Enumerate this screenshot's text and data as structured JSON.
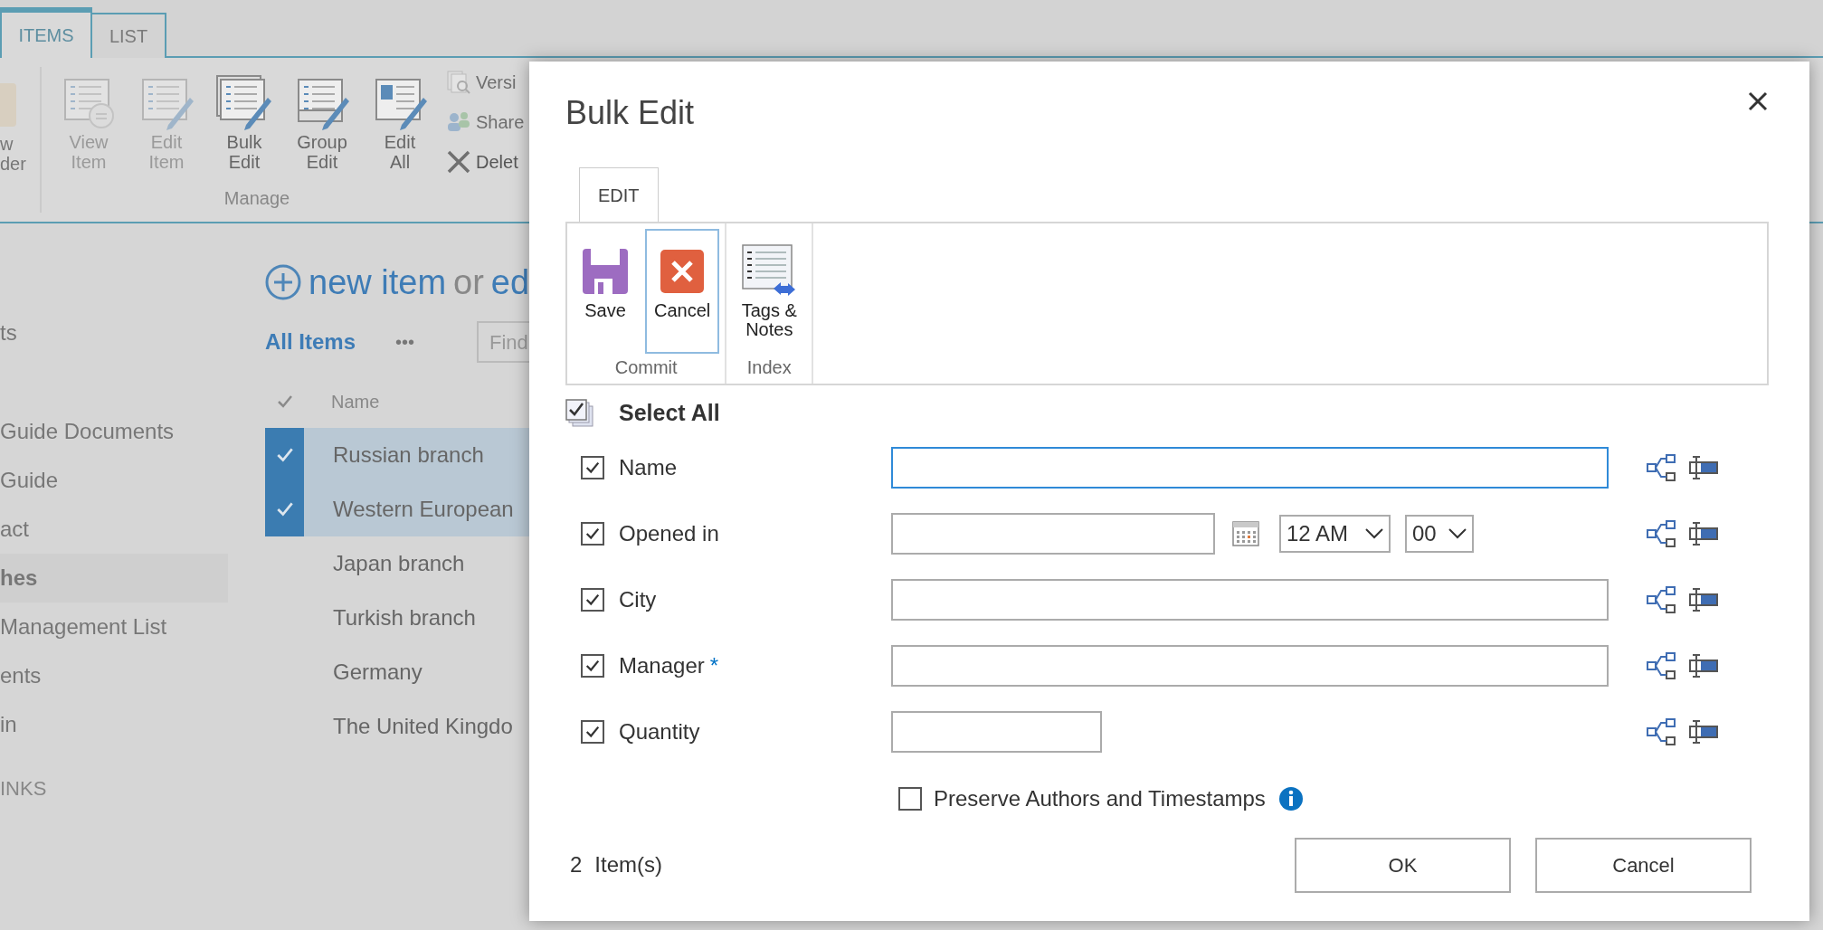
{
  "ribbon_tabs": [
    {
      "label": "ITEMS",
      "selected": true
    },
    {
      "label": "LIST",
      "selected": false
    }
  ],
  "ribbon": {
    "cut_button": {
      "lines": [
        "w",
        "der"
      ]
    },
    "large_buttons": [
      {
        "kind": "view",
        "lines": [
          "View",
          "Item"
        ],
        "disabled": true
      },
      {
        "kind": "edit",
        "lines": [
          "Edit",
          "Item"
        ],
        "disabled": true
      },
      {
        "kind": "bulk",
        "lines": [
          "Bulk",
          "Edit"
        ],
        "disabled": false
      },
      {
        "kind": "group",
        "lines": [
          "Group",
          "Edit"
        ],
        "disabled": false
      },
      {
        "kind": "editall",
        "lines": [
          "Edit",
          "All"
        ],
        "disabled": false
      }
    ],
    "group_label": "Manage",
    "small_buttons": [
      {
        "kind": "versions",
        "label": "Versi",
        "disabled": true
      },
      {
        "kind": "share",
        "label": "Share",
        "disabled": true
      },
      {
        "kind": "delete",
        "label": "Delet",
        "disabled": false
      }
    ]
  },
  "left_nav": {
    "items": [
      {
        "label": "ts",
        "selected": false
      },
      {
        "label": "Guide Documents",
        "selected": false
      },
      {
        "label": "Guide",
        "selected": false
      },
      {
        "label": "act",
        "selected": false
      },
      {
        "label": "hes",
        "selected": true
      },
      {
        "label": "Management List",
        "selected": false
      },
      {
        "label": "ents",
        "selected": false
      },
      {
        "label": "in",
        "selected": false
      }
    ],
    "heading": "INKS"
  },
  "new_item": {
    "link": "new item",
    "joiner": "or",
    "edit": "ed"
  },
  "views": {
    "current": "All Items",
    "more": "•••",
    "search_placeholder": "Find"
  },
  "list": {
    "columns": [
      "Name"
    ],
    "rows": [
      {
        "name": "Russian branch",
        "selected": true
      },
      {
        "name": "Western European",
        "selected": true
      },
      {
        "name": "Japan branch",
        "selected": false
      },
      {
        "name": "Turkish branch",
        "selected": false
      },
      {
        "name": "Germany",
        "selected": false
      },
      {
        "name": "The United Kingdo",
        "selected": false
      }
    ]
  },
  "dialog": {
    "title": "Bulk Edit",
    "tabs": [
      {
        "label": "EDIT",
        "selected": true
      }
    ],
    "groups": [
      {
        "label": "Commit",
        "buttons": [
          {
            "kind": "save",
            "lines": [
              "Save"
            ],
            "focused": false
          },
          {
            "kind": "cancel",
            "lines": [
              "Cancel"
            ],
            "focused": true
          }
        ]
      },
      {
        "label": "Index",
        "buttons": [
          {
            "kind": "tags",
            "lines": [
              "Tags &",
              "Notes"
            ],
            "focused": false
          }
        ]
      }
    ],
    "select_all": "Select All",
    "fields": [
      {
        "kind": "text",
        "label": "Name",
        "checked": true,
        "focused": true,
        "required": false
      },
      {
        "kind": "datetime",
        "label": "Opened in",
        "checked": true,
        "focused": false,
        "required": false,
        "hour": "12 AM",
        "minute": "00"
      },
      {
        "kind": "text",
        "label": "City",
        "checked": true,
        "focused": false,
        "required": false
      },
      {
        "kind": "text",
        "label": "Manager",
        "checked": true,
        "focused": false,
        "required": true,
        "required_mark": "*"
      },
      {
        "kind": "number",
        "label": "Quantity",
        "checked": true,
        "focused": false,
        "required": false
      }
    ],
    "preserve": {
      "label": "Preserve Authors and Timestamps",
      "checked": false
    },
    "item_count": {
      "count": "2",
      "unit": "Item(s)"
    },
    "buttons": [
      "OK",
      "Cancel"
    ]
  }
}
